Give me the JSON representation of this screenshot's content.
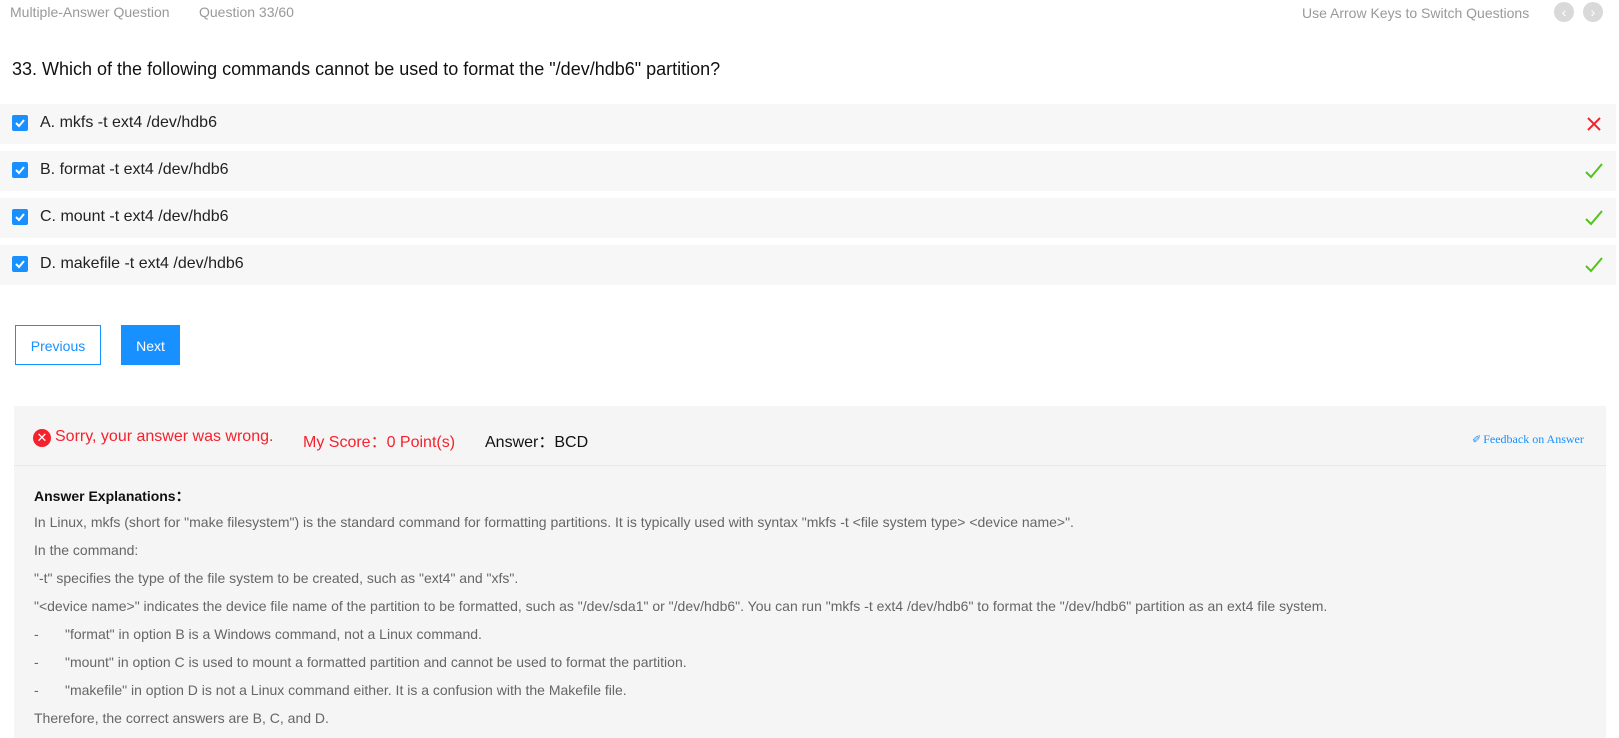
{
  "header": {
    "question_type": "Multiple-Answer Question",
    "question_counter": "Question 33/60",
    "nav_hint": "Use Arrow Keys to Switch Questions",
    "prev_icon": "‹",
    "next_icon": "›"
  },
  "question": {
    "text": "33. Which of the following commands cannot be used to format the \"/dev/hdb6\" partition?"
  },
  "options": [
    {
      "label": "A. mkfs -t ext4 /dev/hdb6",
      "checked": true,
      "result": "incorrect",
      "result_icon": "cross-icon"
    },
    {
      "label": "B. format -t ext4 /dev/hdb6",
      "checked": true,
      "result": "correct",
      "result_icon": "check-icon"
    },
    {
      "label": "C. mount -t ext4 /dev/hdb6",
      "checked": true,
      "result": "correct",
      "result_icon": "check-icon"
    },
    {
      "label": "D. makefile -t ext4 /dev/hdb6",
      "checked": true,
      "result": "correct",
      "result_icon": "check-icon"
    }
  ],
  "buttons": {
    "previous": "Previous",
    "next": "Next"
  },
  "result": {
    "error_icon": "✕",
    "status": "Sorry, your answer was wrong.",
    "score": "My Score：0 Point(s)",
    "answer": "Answer：BCD",
    "feedback_icon": "✐",
    "feedback": "Feedback on Answer"
  },
  "explanation": {
    "title": "Answer Explanations：",
    "lines": [
      "In Linux, mkfs (short for \"make filesystem\") is the standard command for formatting partitions. It is typically used with syntax \"mkfs -t <file system type> <device name>\".",
      "In the command:",
      "\"-t\" specifies the type of the file system to be created, such as \"ext4\" and \"xfs\".",
      "\"<device name>\" indicates the device file name of the partition to be formatted, such as \"/dev/sda1\" or \"/dev/hdb6\". You can run \"mkfs -t ext4 /dev/hdb6\" to format the \"/dev/hdb6\" partition as an ext4 file system."
    ],
    "bullets": [
      {
        "dash": "-",
        "text": "\"format\" in option B is a Windows command, not a Linux command."
      },
      {
        "dash": "-",
        "text": "\"mount\" in option C is used to mount a formatted partition and cannot be used to format the partition."
      },
      {
        "dash": "-",
        "text": "\"makefile\" in option D is not a Linux command either. It is a confusion with the Makefile file."
      }
    ],
    "conclusion": "Therefore, the correct answers are B, C, and D."
  },
  "colors": {
    "accent": "#1890ff",
    "error": "#f5222d",
    "success": "#52c41a"
  }
}
